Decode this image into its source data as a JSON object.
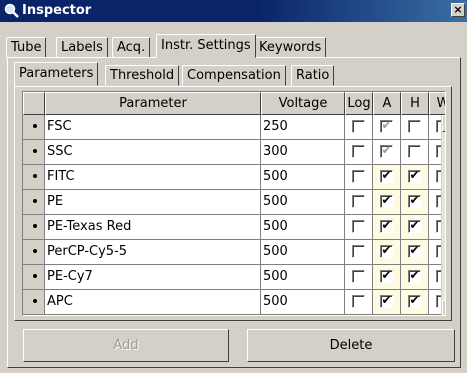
{
  "window": {
    "title": "Inspector",
    "close_icon": "×"
  },
  "tabs": [
    "Tube",
    "Labels",
    "Acq.",
    "Instr. Settings",
    "Keywords"
  ],
  "active_tab": "Instr. Settings",
  "subtabs": [
    "Parameters",
    "Threshold",
    "Compensation",
    "Ratio"
  ],
  "active_subtab": "Parameters",
  "grid": {
    "headers": {
      "parameter": "Parameter",
      "voltage": "Voltage",
      "log": "Log",
      "a": "A",
      "h": "H",
      "w": "W"
    },
    "rows": [
      {
        "parameter": "FSC",
        "voltage": "250",
        "log": false,
        "a": true,
        "a_disabled": true,
        "h": false,
        "w": false
      },
      {
        "parameter": "SSC",
        "voltage": "300",
        "log": false,
        "a": true,
        "a_disabled": true,
        "h": false,
        "w": false
      },
      {
        "parameter": "FITC",
        "voltage": "500",
        "log": false,
        "a": true,
        "a_disabled": false,
        "h": true,
        "w": false
      },
      {
        "parameter": "PE",
        "voltage": "500",
        "log": false,
        "a": true,
        "a_disabled": false,
        "h": true,
        "w": false
      },
      {
        "parameter": "PE-Texas Red",
        "voltage": "500",
        "log": false,
        "a": true,
        "a_disabled": false,
        "h": true,
        "w": false
      },
      {
        "parameter": "PerCP-Cy5-5",
        "voltage": "500",
        "log": false,
        "a": true,
        "a_disabled": false,
        "h": true,
        "w": false
      },
      {
        "parameter": "PE-Cy7",
        "voltage": "500",
        "log": false,
        "a": true,
        "a_disabled": false,
        "h": true,
        "w": false
      },
      {
        "parameter": "APC",
        "voltage": "500",
        "log": false,
        "a": true,
        "a_disabled": false,
        "h": true,
        "w": false
      }
    ]
  },
  "buttons": {
    "add": "Add",
    "delete": "Delete"
  },
  "scroll": {
    "up_icon": "▲",
    "down_icon": "▼"
  },
  "colors": {
    "titlebar": "#0a246a",
    "face": "#d4d0c8",
    "highlight_cell": "#fffbe2"
  }
}
